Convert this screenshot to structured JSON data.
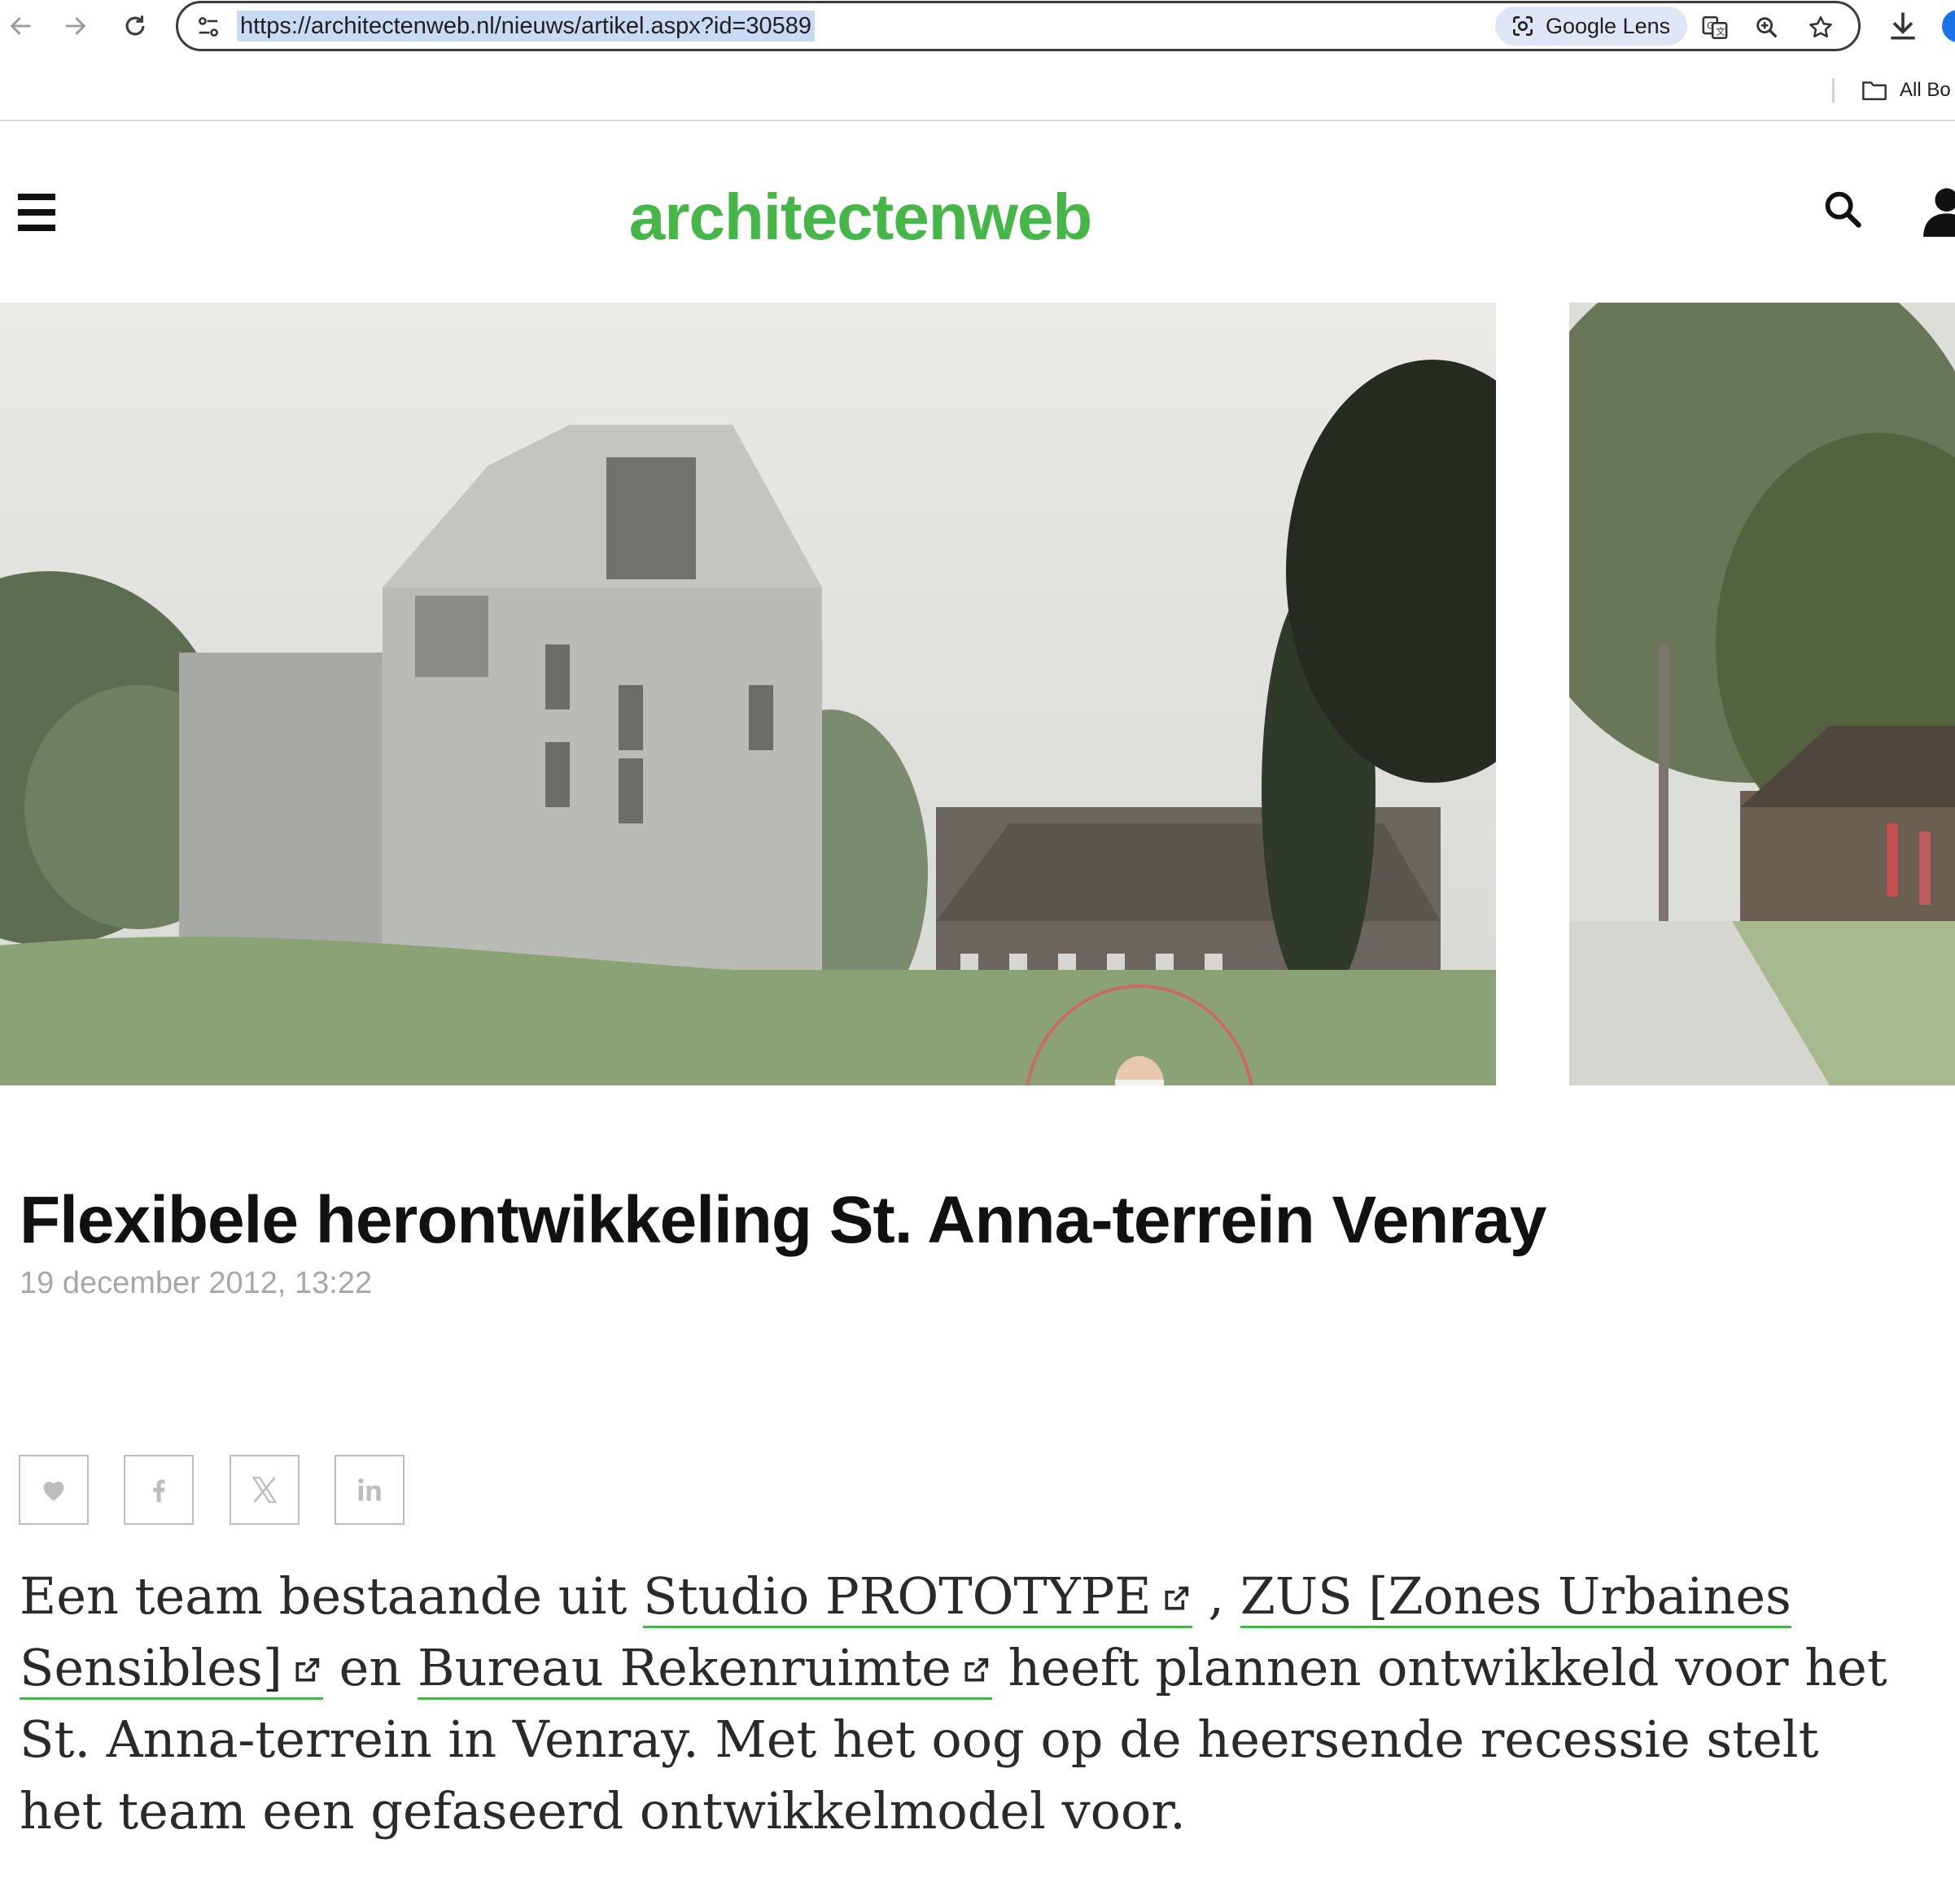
{
  "browser": {
    "url": "https://architectenweb.nl/nieuws/artikel.aspx?id=30589",
    "lens_label": "Google Lens",
    "bookmarks_label": "All Bo"
  },
  "site": {
    "brand": "architectenweb",
    "brand_color": "#46b649"
  },
  "hero": {
    "slides": [
      {
        "scene": "rendering of new wooden residential buildings beside the St. Anna monastery with a girl skipping rope in the foreground"
      },
      {
        "scene": "photo of tree-lined path and brick buildings on the St. Anna terrain"
      }
    ]
  },
  "article": {
    "title": "Flexibele herontwikkeling St. Anna-terrein Venray",
    "date": "19 december 2012, 13:22",
    "share_icons": [
      "heart-icon",
      "facebook-icon",
      "x-icon",
      "linkedin-icon"
    ],
    "lead": {
      "part1": "Een team bestaande uit ",
      "link1": "Studio PROTOTYPE",
      "sep1": " , ",
      "link2": "ZUS [Zones Urbaines Sensibles]",
      "sep2": " en ",
      "link3": "Bureau Rekenruimte",
      "part2": "  heeft plannen ontwikkeld voor het St. Anna-terrein in Venray. Met het oog op de heersende recessie stelt het team een gefaseerd ontwikkelmodel voor."
    }
  }
}
